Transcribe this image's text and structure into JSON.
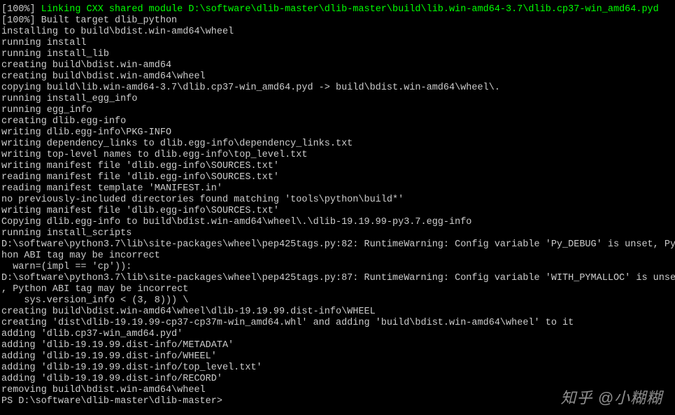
{
  "lines": [
    {
      "segments": [
        {
          "text": "[100%] ",
          "class": "white"
        },
        {
          "text": "Linking CXX shared module D:\\software\\dlib-master\\dlib-master\\build\\lib.win-amd64-3.7\\dlib.cp37-win_amd64.pyd",
          "class": "green"
        }
      ]
    },
    {
      "segments": [
        {
          "text": "[100%] Built target dlib_python",
          "class": "white"
        }
      ]
    },
    {
      "segments": [
        {
          "text": "installing to build\\bdist.win-amd64\\wheel",
          "class": "white"
        }
      ]
    },
    {
      "segments": [
        {
          "text": "running install",
          "class": "white"
        }
      ]
    },
    {
      "segments": [
        {
          "text": "running install_lib",
          "class": "white"
        }
      ]
    },
    {
      "segments": [
        {
          "text": "creating build\\bdist.win-amd64",
          "class": "white"
        }
      ]
    },
    {
      "segments": [
        {
          "text": "creating build\\bdist.win-amd64\\wheel",
          "class": "white"
        }
      ]
    },
    {
      "segments": [
        {
          "text": "copying build\\lib.win-amd64-3.7\\dlib.cp37-win_amd64.pyd -> build\\bdist.win-amd64\\wheel\\.",
          "class": "white"
        }
      ]
    },
    {
      "segments": [
        {
          "text": "running install_egg_info",
          "class": "white"
        }
      ]
    },
    {
      "segments": [
        {
          "text": "running egg_info",
          "class": "white"
        }
      ]
    },
    {
      "segments": [
        {
          "text": "creating dlib.egg-info",
          "class": "white"
        }
      ]
    },
    {
      "segments": [
        {
          "text": "writing dlib.egg-info\\PKG-INFO",
          "class": "white"
        }
      ]
    },
    {
      "segments": [
        {
          "text": "writing dependency_links to dlib.egg-info\\dependency_links.txt",
          "class": "white"
        }
      ]
    },
    {
      "segments": [
        {
          "text": "writing top-level names to dlib.egg-info\\top_level.txt",
          "class": "white"
        }
      ]
    },
    {
      "segments": [
        {
          "text": "writing manifest file 'dlib.egg-info\\SOURCES.txt'",
          "class": "white"
        }
      ]
    },
    {
      "segments": [
        {
          "text": "reading manifest file 'dlib.egg-info\\SOURCES.txt'",
          "class": "white"
        }
      ]
    },
    {
      "segments": [
        {
          "text": "reading manifest template 'MANIFEST.in'",
          "class": "white"
        }
      ]
    },
    {
      "segments": [
        {
          "text": "no previously-included directories found matching 'tools\\python\\build*'",
          "class": "white"
        }
      ]
    },
    {
      "segments": [
        {
          "text": "writing manifest file 'dlib.egg-info\\SOURCES.txt'",
          "class": "white"
        }
      ]
    },
    {
      "segments": [
        {
          "text": "Copying dlib.egg-info to build\\bdist.win-amd64\\wheel\\.\\dlib-19.19.99-py3.7.egg-info",
          "class": "white"
        }
      ]
    },
    {
      "segments": [
        {
          "text": "running install_scripts",
          "class": "white"
        }
      ]
    },
    {
      "segments": [
        {
          "text": "D:\\software\\python3.7\\lib\\site-packages\\wheel\\pep425tags.py:82: RuntimeWarning: Config variable 'Py_DEBUG' is unset, Pyt",
          "class": "white"
        }
      ]
    },
    {
      "segments": [
        {
          "text": "hon ABI tag may be incorrect",
          "class": "white"
        }
      ]
    },
    {
      "segments": [
        {
          "text": "  warn=(impl == 'cp')):",
          "class": "white"
        }
      ]
    },
    {
      "segments": [
        {
          "text": "D:\\software\\python3.7\\lib\\site-packages\\wheel\\pep425tags.py:87: RuntimeWarning: Config variable 'WITH_PYMALLOC' is unset",
          "class": "white"
        }
      ]
    },
    {
      "segments": [
        {
          "text": ", Python ABI tag may be incorrect",
          "class": "white"
        }
      ]
    },
    {
      "segments": [
        {
          "text": "    sys.version_info < (3, 8))) \\",
          "class": "white"
        }
      ]
    },
    {
      "segments": [
        {
          "text": "creating build\\bdist.win-amd64\\wheel\\dlib-19.19.99.dist-info\\WHEEL",
          "class": "white"
        }
      ]
    },
    {
      "segments": [
        {
          "text": "creating 'dist\\dlib-19.19.99-cp37-cp37m-win_amd64.whl' and adding 'build\\bdist.win-amd64\\wheel' to it",
          "class": "white"
        }
      ]
    },
    {
      "segments": [
        {
          "text": "adding 'dlib.cp37-win_amd64.pyd'",
          "class": "white"
        }
      ]
    },
    {
      "segments": [
        {
          "text": "adding 'dlib-19.19.99.dist-info/METADATA'",
          "class": "white"
        }
      ]
    },
    {
      "segments": [
        {
          "text": "adding 'dlib-19.19.99.dist-info/WHEEL'",
          "class": "white"
        }
      ]
    },
    {
      "segments": [
        {
          "text": "adding 'dlib-19.19.99.dist-info/top_level.txt'",
          "class": "white"
        }
      ]
    },
    {
      "segments": [
        {
          "text": "adding 'dlib-19.19.99.dist-info/RECORD'",
          "class": "white"
        }
      ]
    },
    {
      "segments": [
        {
          "text": "removing build\\bdist.win-amd64\\wheel",
          "class": "white"
        }
      ]
    },
    {
      "segments": [
        {
          "text": "PS D:\\software\\dlib-master\\dlib-master>",
          "class": "white"
        }
      ]
    }
  ],
  "watermark": "知乎 @小糊糊"
}
